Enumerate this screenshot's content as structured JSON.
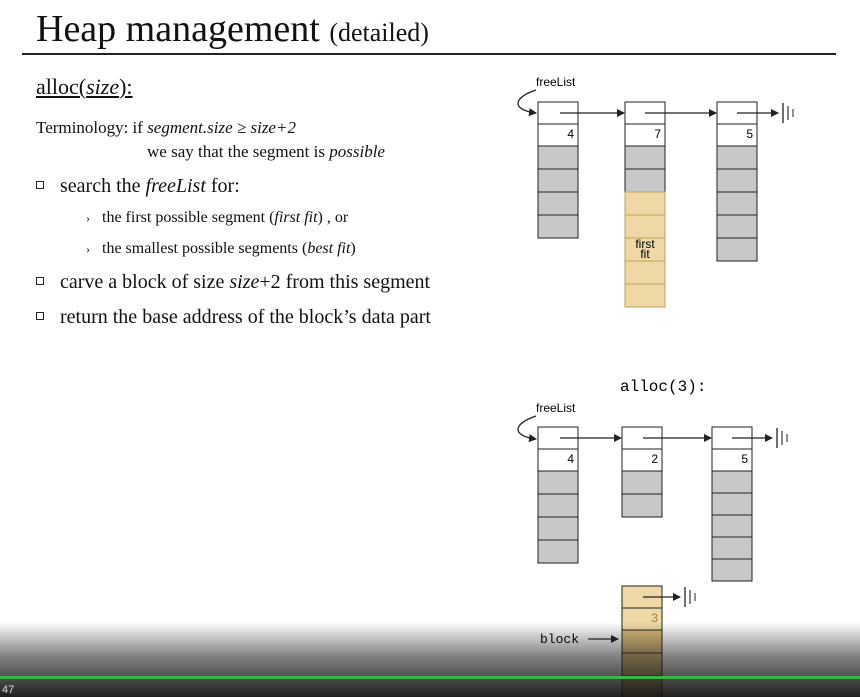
{
  "slide": {
    "title": "Heap management",
    "title_sub": "(detailed)",
    "alloc_prefix": "alloc(",
    "alloc_arg": "size",
    "alloc_suffix": "):",
    "term_label": "Terminology: if",
    "term_cond": "segment.size ≥ size+2",
    "term_line2a": "we say that the segment is",
    "term_line2b": "possible",
    "bullets": [
      {
        "a": "search the",
        "b": "freeList",
        "c": "for:"
      },
      {
        "a": "carve a block of size",
        "b": "size",
        "c": "+2 from this segment"
      },
      {
        "a": "return the base address of the block’s data part",
        "b": "",
        "c": ""
      }
    ],
    "subbullets": [
      {
        "a": "the first possible segment (",
        "b": "first fit",
        "c": ") , or"
      },
      {
        "a": "the smallest possible segments (",
        "b": "best fit",
        "c": ")"
      }
    ]
  },
  "diagram1": {
    "freelist_label": "freeList",
    "sizes": [
      "4",
      "7",
      "5"
    ],
    "first_fit_label_1": "first",
    "first_fit_label_2": "fit"
  },
  "diagram2": {
    "call_label": "alloc(3):",
    "freelist_label": "freeList",
    "sizes": [
      "4",
      "2",
      "5"
    ],
    "block_size": "3",
    "block_label": "block"
  },
  "player": {
    "time": "47",
    "progress": 1.0
  },
  "colors": {
    "cell_gray": "#c8c8c8",
    "cell_highlight": "#eed9a6",
    "cell_highlight_dark": "#dcbd78"
  }
}
